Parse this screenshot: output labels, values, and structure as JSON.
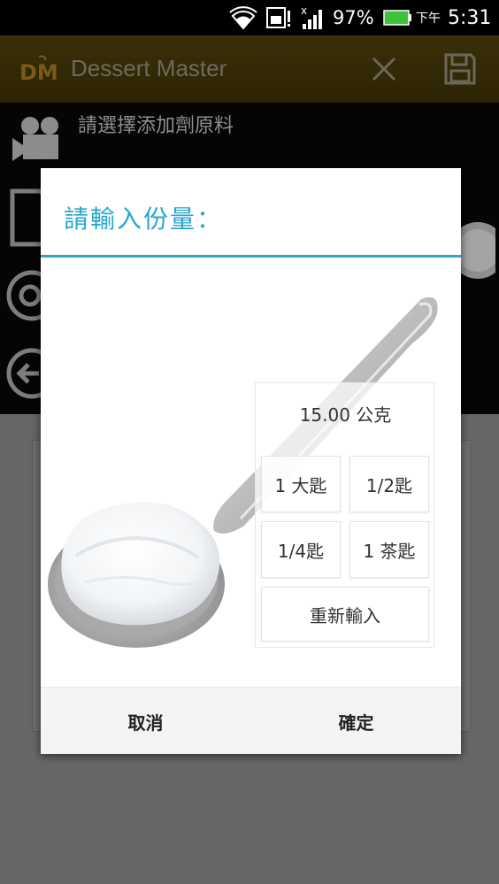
{
  "status_bar": {
    "battery_percent": "97%",
    "ampm": "下午",
    "time": "5:31",
    "icons": [
      "wifi-icon",
      "sim-icon",
      "signal-icon",
      "battery-icon"
    ]
  },
  "action_bar": {
    "logo_text": "DM",
    "title": "Dessert Master",
    "close_icon": "close-icon",
    "save_icon": "save-icon",
    "background_color": "#2d2405",
    "title_color": "#6d6a5c"
  },
  "background": {
    "heading": "請選擇添加劑原料"
  },
  "dialog": {
    "title": "請輸入份量：",
    "accent_color": "#2aa6cc",
    "amount": "15.00 公克",
    "quantity_buttons": [
      {
        "label": "1 大匙"
      },
      {
        "label": "1/2匙"
      },
      {
        "label": "1/4匙"
      },
      {
        "label": "1 茶匙"
      },
      {
        "label": "重新輸入"
      }
    ],
    "footer": {
      "cancel": "取消",
      "ok": "確定"
    }
  }
}
